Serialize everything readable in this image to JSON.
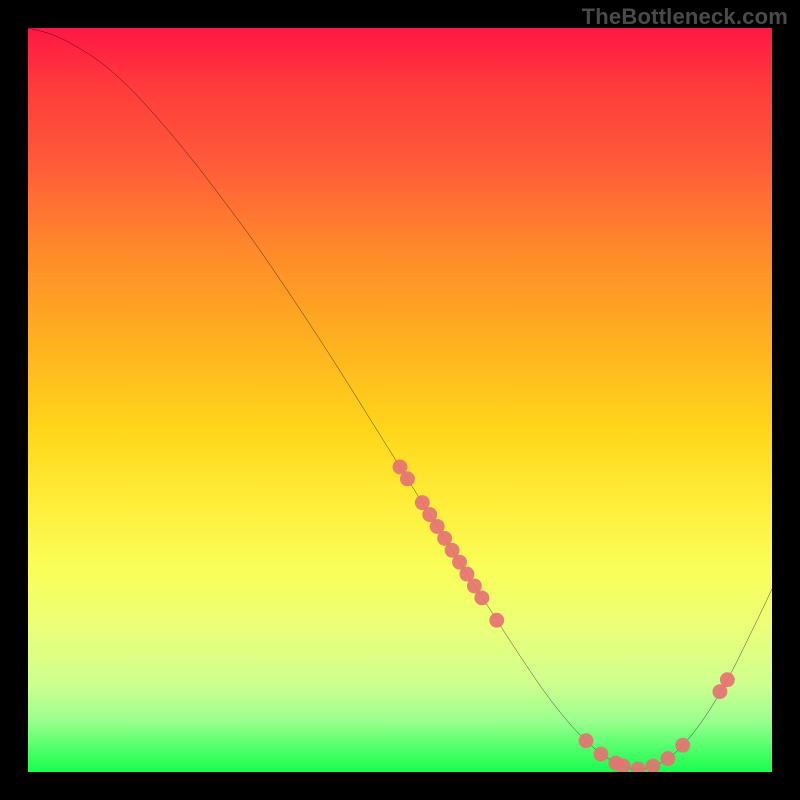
{
  "watermark": "TheBottleneck.com",
  "chart_data": {
    "type": "line",
    "title": "",
    "xlabel": "",
    "ylabel": "",
    "ylim": [
      0,
      100
    ],
    "xlim": [
      0,
      100
    ],
    "series": [
      {
        "name": "curve",
        "x": [
          0,
          3,
          6,
          10,
          14,
          18,
          22,
          26,
          30,
          34,
          38,
          42,
          46,
          50,
          54,
          58,
          62,
          66,
          70,
          74,
          78,
          82,
          86,
          90,
          94,
          98,
          100
        ],
        "y": [
          100,
          99.2,
          97.8,
          95.2,
          91.6,
          87.2,
          82.4,
          77.2,
          71.8,
          66,
          60,
          53.8,
          47.4,
          41,
          34.6,
          28.2,
          22,
          15.8,
          10,
          5.2,
          1.8,
          0.4,
          1.8,
          6,
          12.4,
          20.4,
          24.6
        ]
      }
    ],
    "points": [
      {
        "x": 50,
        "y": 41
      },
      {
        "x": 51,
        "y": 39.4
      },
      {
        "x": 53,
        "y": 36.2
      },
      {
        "x": 54,
        "y": 34.6
      },
      {
        "x": 55,
        "y": 33
      },
      {
        "x": 56,
        "y": 31.4
      },
      {
        "x": 57,
        "y": 29.8
      },
      {
        "x": 58,
        "y": 28.2
      },
      {
        "x": 59,
        "y": 26.6
      },
      {
        "x": 60,
        "y": 25
      },
      {
        "x": 61,
        "y": 23.4
      },
      {
        "x": 63,
        "y": 20.4
      },
      {
        "x": 75,
        "y": 4.2
      },
      {
        "x": 77,
        "y": 2.4
      },
      {
        "x": 79,
        "y": 1.2
      },
      {
        "x": 80,
        "y": 0.8
      },
      {
        "x": 82,
        "y": 0.4
      },
      {
        "x": 84,
        "y": 0.8
      },
      {
        "x": 86,
        "y": 1.8
      },
      {
        "x": 88,
        "y": 3.6
      },
      {
        "x": 93,
        "y": 10.8
      },
      {
        "x": 94,
        "y": 12.4
      }
    ]
  }
}
